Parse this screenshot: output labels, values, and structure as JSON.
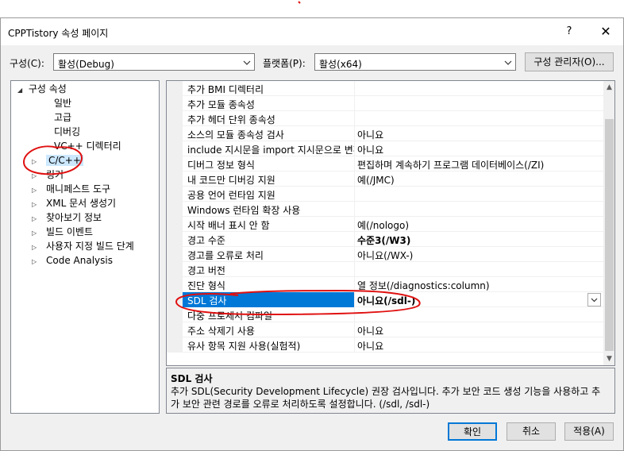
{
  "window": {
    "title": "CPPTistory 속성 페이지",
    "help": "?",
    "close": "✕"
  },
  "config": {
    "config_label": "구성(C):",
    "config_value": "활성(Debug)",
    "platform_label": "플랫폼(P):",
    "platform_value": "활성(x64)",
    "manager_button": "구성 관리자(O)..."
  },
  "tree": {
    "root": "구성 속성",
    "items": [
      {
        "label": "일반",
        "expandable": false
      },
      {
        "label": "고급",
        "expandable": false
      },
      {
        "label": "디버깅",
        "expandable": false
      },
      {
        "label": "VC++ 디렉터리",
        "expandable": false
      },
      {
        "label": "C/C++",
        "expandable": true,
        "selected": true
      },
      {
        "label": "링커",
        "expandable": true
      },
      {
        "label": "매니페스트 도구",
        "expandable": true
      },
      {
        "label": "XML 문서 생성기",
        "expandable": true
      },
      {
        "label": "찾아보기 정보",
        "expandable": true
      },
      {
        "label": "빌드 이벤트",
        "expandable": true
      },
      {
        "label": "사용자 지정 빌드 단계",
        "expandable": true
      },
      {
        "label": "Code Analysis",
        "expandable": true
      }
    ]
  },
  "grid": {
    "rows": [
      {
        "name": "추가 BMI 디렉터리",
        "value": ""
      },
      {
        "name": "추가 모듈 종속성",
        "value": ""
      },
      {
        "name": "추가 헤더 단위 종속성",
        "value": ""
      },
      {
        "name": "소스의 모듈 종속성 검사",
        "value": "아니요"
      },
      {
        "name": "include 지시문을 import 지시문으로 변환",
        "value": "아니요"
      },
      {
        "name": "디버그 정보 형식",
        "value": "편집하며 계속하기 프로그램 데이터베이스(/ZI)"
      },
      {
        "name": "내 코드만 디버깅 지원",
        "value": "예(/JMC)"
      },
      {
        "name": "공용 언어 런타임 지원",
        "value": ""
      },
      {
        "name": "Windows 런타임 확장 사용",
        "value": ""
      },
      {
        "name": "시작 배너 표시 안 함",
        "value": "예(/nologo)"
      },
      {
        "name": "경고 수준",
        "value": "수준3(/W3)",
        "bold": true
      },
      {
        "name": "경고를 오류로 처리",
        "value": "아니요(/WX-)"
      },
      {
        "name": "경고 버전",
        "value": ""
      },
      {
        "name": "진단 형식",
        "value": "열 정보(/diagnostics:column)"
      },
      {
        "name": "SDL 검사",
        "value": "아니요(/sdl-)",
        "selected": true
      },
      {
        "name": "다중 프로세서 컴파일",
        "value": ""
      },
      {
        "name": "주소 삭제기 사용",
        "value": "아니요"
      },
      {
        "name": "유사 항목 지원 사용(실험적)",
        "value": "아니요"
      }
    ]
  },
  "description": {
    "title": "SDL 검사",
    "text": "추가 SDL(Security Development Lifecycle) 권장 검사입니다. 추가 보안 코드 생성 기능을 사용하고 추가 보안 관련 경로를 오류로 처리하도록 설정합니다. (/sdl, /sdl-)"
  },
  "buttons": {
    "ok": "확인",
    "cancel": "취소",
    "apply": "적용(A)"
  },
  "colors": {
    "selection": "#0078d7",
    "tree_selection": "#cce8ff",
    "annotation": "#e01010"
  }
}
